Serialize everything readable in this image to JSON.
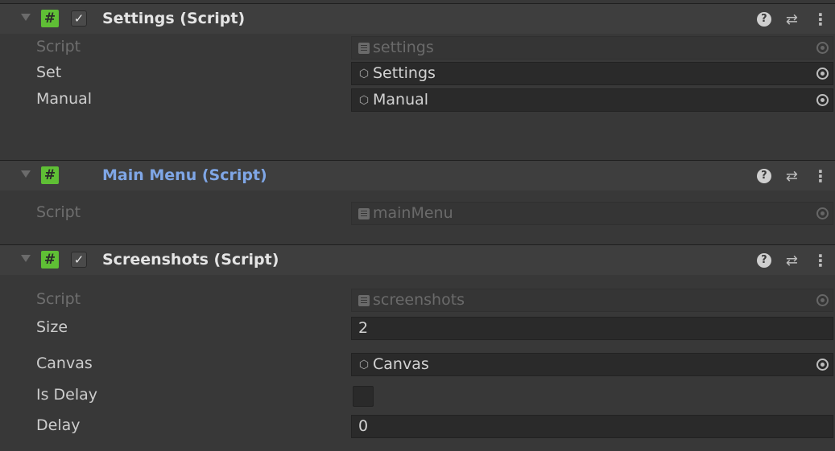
{
  "components": [
    {
      "title": "Settings (Script)",
      "enabled": true,
      "fields": [
        {
          "label": "Script",
          "value": "settings",
          "kind": "script-ref",
          "readonly": true
        },
        {
          "label": "Set",
          "value": "Settings",
          "kind": "object-ref"
        },
        {
          "label": "Manual",
          "value": "Manual",
          "kind": "object-ref"
        }
      ]
    },
    {
      "title": "Main Menu (Script)",
      "enabled": null,
      "fields": [
        {
          "label": "Script",
          "value": "mainMenu",
          "kind": "script-ref",
          "readonly": true
        }
      ]
    },
    {
      "title": "Screenshots (Script)",
      "enabled": true,
      "fields": [
        {
          "label": "Script",
          "value": "screenshots",
          "kind": "script-ref",
          "readonly": true
        },
        {
          "label": "Size",
          "value": "2",
          "kind": "number"
        },
        {
          "label": "Canvas",
          "value": "Canvas",
          "kind": "object-ref"
        },
        {
          "label": "Is Delay",
          "value": false,
          "kind": "toggle"
        },
        {
          "label": "Delay",
          "value": "0",
          "kind": "number"
        }
      ]
    }
  ],
  "icons": {
    "script": "#",
    "checkmark": "✓",
    "help": "?",
    "presets": "⇄",
    "menu": "⋮",
    "cube": "⬡"
  },
  "colors": {
    "script_icon": "#5fbf35",
    "link_title": "#7fa6e6",
    "panel": "#383838"
  }
}
